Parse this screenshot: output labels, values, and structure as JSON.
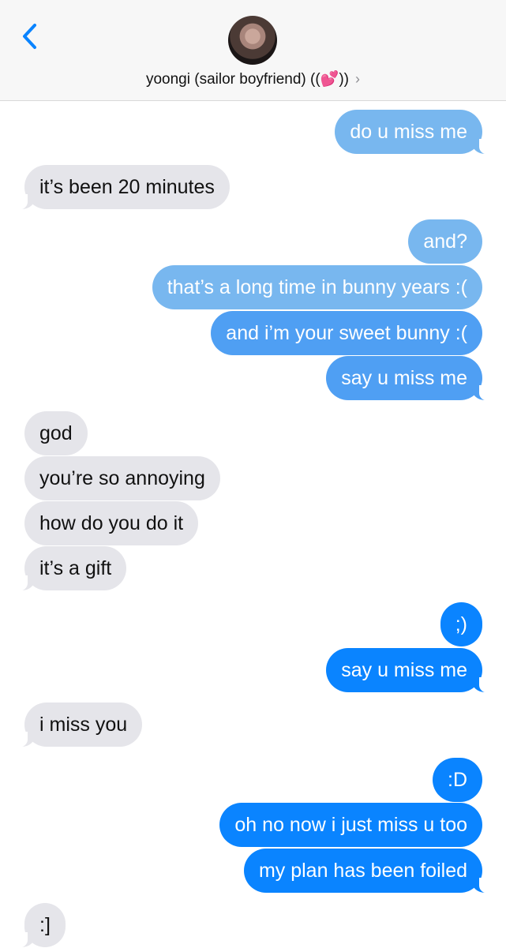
{
  "header": {
    "contact_name": "yoongi (sailor boyfriend) ((💕))",
    "chevron": "›",
    "back_icon": "chevron-left-icon",
    "avatar": "avatar"
  },
  "messages": [
    {
      "from": "me",
      "text": "do u miss me"
    },
    {
      "from": "them",
      "text": "it’s been 20 minutes"
    },
    {
      "from": "me",
      "text": "and?"
    },
    {
      "from": "me",
      "text": "that’s a long time in bunny years :("
    },
    {
      "from": "me",
      "text": "and i’m your sweet bunny :("
    },
    {
      "from": "me",
      "text": "say u miss me"
    },
    {
      "from": "them",
      "text": "god"
    },
    {
      "from": "them",
      "text": "you’re so annoying"
    },
    {
      "from": "them",
      "text": "how do you do it"
    },
    {
      "from": "them",
      "text": "it’s a gift"
    },
    {
      "from": "me",
      "text": ";)"
    },
    {
      "from": "me",
      "text": "say u miss me"
    },
    {
      "from": "them",
      "text": "i miss you"
    },
    {
      "from": "me",
      "text": ":D"
    },
    {
      "from": "me",
      "text": "oh no now i just miss u too"
    },
    {
      "from": "me",
      "text": "my plan has been foiled"
    },
    {
      "from": "them",
      "text": ":]"
    }
  ],
  "colors": {
    "outgoing_bubble": "#0a84ff",
    "incoming_bubble": "#e5e5ea",
    "back_chevron": "#0a84ff"
  }
}
